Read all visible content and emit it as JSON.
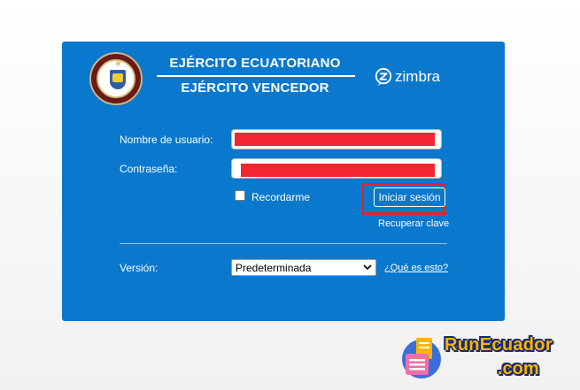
{
  "header": {
    "title_line1": "EJÉRCITO ECUATORIANO",
    "title_line2": "EJÉRCITO VENCEDOR",
    "brand": "zimbra"
  },
  "login_form": {
    "username_label": "Nombre de usuario:",
    "password_label": "Contraseña:",
    "remember_label": "Recordarme",
    "remember_checked": false,
    "submit_label": "Iniciar sesión",
    "recover_link": "Recuperar clave",
    "version_label": "Versión:",
    "version_selected": "Predeterminada",
    "whats_this_link": "¿Qué es esto?"
  },
  "watermark": {
    "line1": "RunEcuador",
    "line2": ".com"
  },
  "colors": {
    "panel_bg": "#0a78cc",
    "redaction": "#f22631",
    "highlight_box": "#e0232e",
    "watermark_text": "#f7b500"
  }
}
